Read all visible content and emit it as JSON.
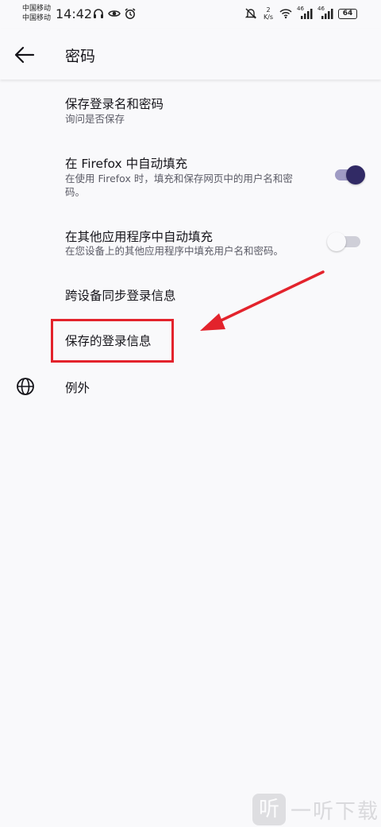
{
  "status_bar": {
    "carrier_1": "中国移动",
    "carrier_2": "中国移动",
    "time": "14:42",
    "net_speed_value": "2",
    "net_speed_unit": "K/s",
    "signal_1_label": "46",
    "signal_2_label": "46",
    "battery": "64",
    "icons": [
      "headset-icon",
      "eye-icon",
      "alarm-icon",
      "mute-icon",
      "wifi-icon",
      "signal-icon",
      "signal-icon",
      "battery-icon"
    ]
  },
  "app_bar": {
    "title": "密码",
    "back_icon": "arrow-left-icon"
  },
  "settings": {
    "save_logins": {
      "title": "保存登录名和密码",
      "subtitle": "询问是否保存"
    },
    "autofill_firefox": {
      "title": "在 Firefox 中自动填充",
      "subtitle": "在使用 Firefox 时，填充和保存网页中的用户名和密码。",
      "enabled": true
    },
    "autofill_other_apps": {
      "title": "在其他应用程序中自动填充",
      "subtitle": "在您设备上的其他应用程序中填充用户名和密码。",
      "enabled": false
    },
    "sync_logins": {
      "title": "跨设备同步登录信息"
    },
    "saved_logins": {
      "title": "保存的登录信息"
    },
    "exceptions": {
      "title": "例外",
      "icon": "globe-icon"
    }
  },
  "annotation": {
    "highlight_color": "#e3232c",
    "arrow_color": "#e3232c"
  },
  "colors": {
    "switch_on_thumb": "#312a65",
    "switch_on_track": "#9f9bc4",
    "switch_off_thumb": "#f9f9fb",
    "switch_off_track": "#cfcfd8"
  },
  "watermark": {
    "logo_char": "听",
    "text": "一听下载"
  }
}
